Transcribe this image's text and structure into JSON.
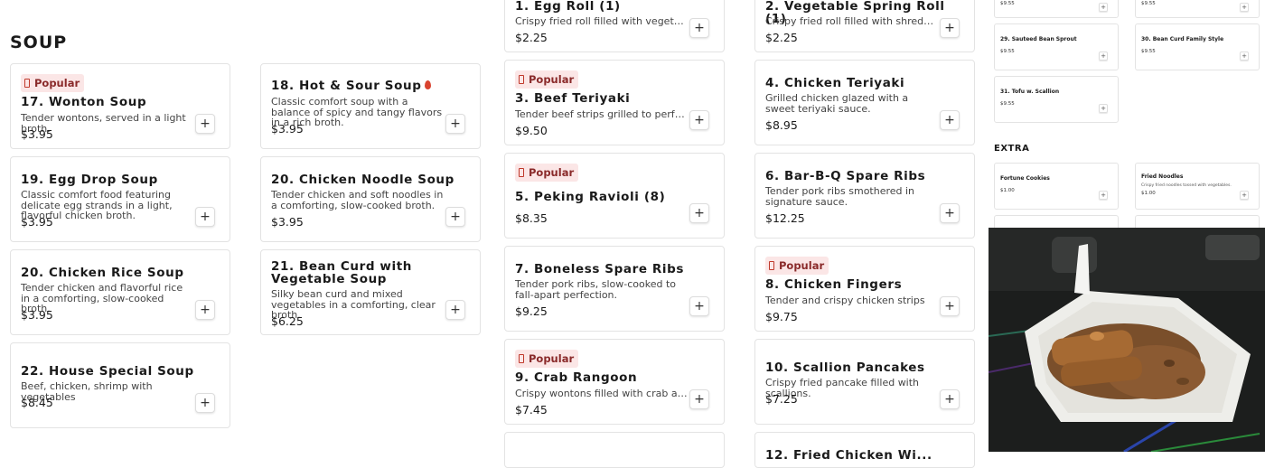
{
  "section": {
    "title": "SOUP",
    "popular_label": "Popular",
    "add_label": "+"
  },
  "items": {
    "egg_roll": {
      "title": "1. Egg Roll (1)",
      "desc": "Crispy fried roll filled with vegetables and",
      "price": "$2.25"
    },
    "spring_roll": {
      "title": "2. Vegetable Spring Roll (1)",
      "desc": "Crispy fried roll filled with shredded...",
      "price": "$2.25"
    },
    "wonton": {
      "title": "17. Wonton Soup",
      "desc": "Tender wontons, served in a light broth.",
      "price": "$3.95"
    },
    "hot_sour": {
      "title": "18. Hot & Sour Soup",
      "desc": "Classic comfort soup with a balance of spicy and tangy flavors in a rich broth.",
      "price": "$3.95"
    },
    "beef_teriyaki": {
      "title": "3. Beef Teriyaki",
      "desc": "Tender beef strips grilled to perfection in",
      "price": "$9.50"
    },
    "chicken_teriyaki": {
      "title": "4. Chicken Teriyaki",
      "desc": "Grilled chicken glazed with a sweet teriyaki sauce.",
      "price": "$8.95"
    },
    "egg_drop": {
      "title": "19. Egg Drop Soup",
      "desc": "Classic comfort food featuring delicate egg strands in a light, flavorful chicken broth.",
      "price": "$3.95"
    },
    "chicken_noodle": {
      "title": "20. Chicken Noodle Soup",
      "desc": "Tender chicken and soft noodles in a comforting, slow-cooked broth.",
      "price": "$3.95"
    },
    "peking_ravioli": {
      "title": "5. Peking Ravioli (8)",
      "desc": "",
      "price": "$8.35"
    },
    "spare_ribs": {
      "title": "6. Bar-B-Q Spare Ribs",
      "desc": "Tender pork ribs smothered in signature sauce.",
      "price": "$12.25"
    },
    "chicken_rice": {
      "title": "20. Chicken Rice Soup",
      "desc": "Tender chicken and flavorful rice in a comforting, slow-cooked broth.",
      "price": "$3.95"
    },
    "bean_curd_veg": {
      "title": "21. Bean Curd with Vegetable Soup",
      "desc": "Silky bean curd and mixed vegetables in a comforting, clear broth.",
      "price": "$6.25"
    },
    "boneless_ribs": {
      "title": "7. Boneless Spare Ribs",
      "desc": "Tender pork ribs, slow-cooked to fall-apart perfection.",
      "price": "$9.25"
    },
    "chicken_fingers": {
      "title": "8. Chicken Fingers",
      "desc": "Tender and crispy chicken strips",
      "price": "$9.75"
    },
    "house_special": {
      "title": "22. House Special Soup",
      "desc": "Beef, chicken, shrimp with vegetables",
      "price": "$8.45"
    },
    "crab_rangoon": {
      "title": "9. Crab Rangoon",
      "desc": "Crispy wontons filled with crab and cream",
      "price": "$7.45"
    },
    "scallion_pancakes": {
      "title": "10. Scallion Pancakes",
      "desc": "Crispy fried pancake filled with scallions.",
      "price": "$7.25"
    },
    "fried_chicken_wings": {
      "title": "12. Fried Chicken Wi..."
    }
  },
  "side": {
    "top_left_price": "$9.55",
    "top_right_price": "$9.55",
    "sauteed_bean_sprout": {
      "title": "29. Sauteed Bean Sprout",
      "price": "$9.55"
    },
    "bean_curd_family": {
      "title": "30. Bean Curd Family Style",
      "price": "$9.55"
    },
    "tofu_scallion": {
      "title": "31. Tofu w. Scallion",
      "price": "$9.55"
    },
    "extra_heading": "EXTRA",
    "fortune_cookies": {
      "title": "Fortune Cookies",
      "price": "$1.00"
    },
    "fried_noodles": {
      "title": "Fried Noodles",
      "desc": "Crispy fried noodles tossed with vegetables.",
      "price": "$1.00"
    }
  },
  "colors": {
    "badge_bg": "#fbe6e6",
    "badge_text": "#8a2a2a",
    "chili": "#d9432f"
  }
}
